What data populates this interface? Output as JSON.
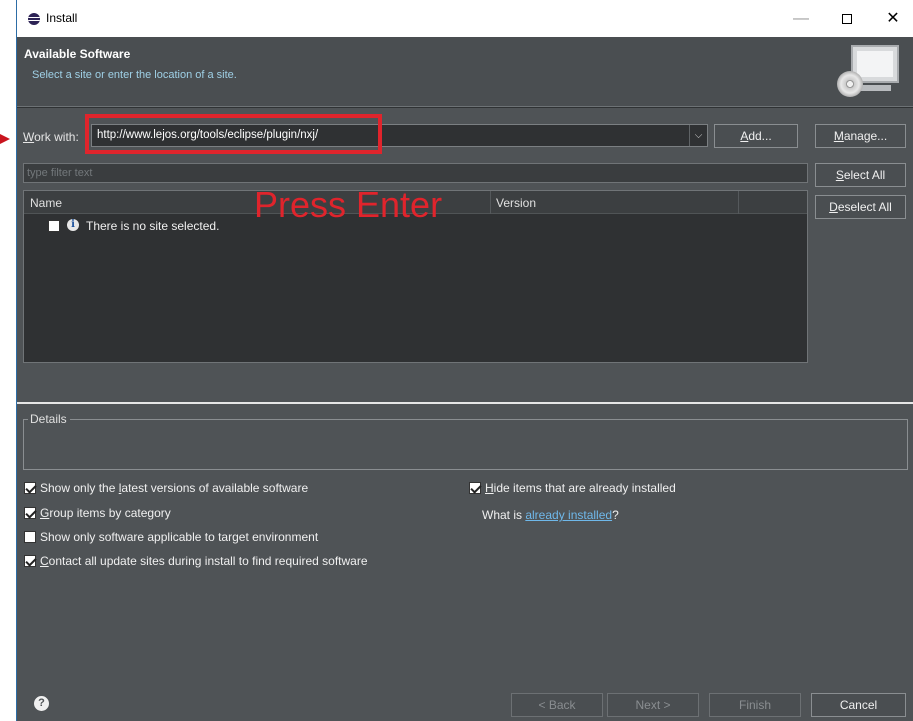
{
  "window": {
    "title": "Install",
    "app_icon": "eclipse-icon"
  },
  "window_controls": {
    "minimize": "—",
    "maximize": "□",
    "close": "✕"
  },
  "banner": {
    "title": "Available Software",
    "description": "Select a site or enter the location of a site.",
    "graphic": "install-software-graphic"
  },
  "work_with": {
    "label_accel": "W",
    "label_rest": "ork with:",
    "value": "http://www.lejos.org/tools/eclipse/plugin/nxj/",
    "add_accel": "A",
    "add_rest": "dd...",
    "manage_accel": "M",
    "manage_rest": "anage..."
  },
  "filter": {
    "placeholder": "type filter text"
  },
  "table": {
    "columns": [
      "Name",
      "Version"
    ],
    "rows": [
      {
        "text": "There is no site selected.",
        "icon": "info-icon",
        "checked": false
      }
    ]
  },
  "buttons": {
    "select_all_accel": "S",
    "select_all_rest": "elect All",
    "deselect_all_accel": "D",
    "deselect_all_rest": "eselect All"
  },
  "annotation": {
    "text": "Press Enter",
    "color": "#e0242c"
  },
  "details": {
    "label": "Details"
  },
  "options": {
    "latest": {
      "pre": "Show only the ",
      "accel": "l",
      "post": "atest versions of available software",
      "checked": true
    },
    "group": {
      "pre": "",
      "accel": "G",
      "post": "roup items by category",
      "checked": true
    },
    "applicable": {
      "pre": "Show only software applicable to target environment",
      "accel": "",
      "post": "",
      "checked": false
    },
    "contact": {
      "pre": "",
      "accel": "C",
      "post": "ontact all update sites during install to find required software",
      "checked": true
    },
    "hide": {
      "pre": "",
      "accel": "H",
      "post": "ide items that are already installed",
      "checked": true
    }
  },
  "what_is": {
    "pre": "What is ",
    "link": "already installed",
    "post": "?"
  },
  "footer": {
    "help_icon": "help-icon",
    "back": "< Back",
    "back_accel": "B",
    "next": "Next >",
    "next_accel": "N",
    "finish": "Finish",
    "finish_accel": "F",
    "cancel": "Cancel"
  }
}
